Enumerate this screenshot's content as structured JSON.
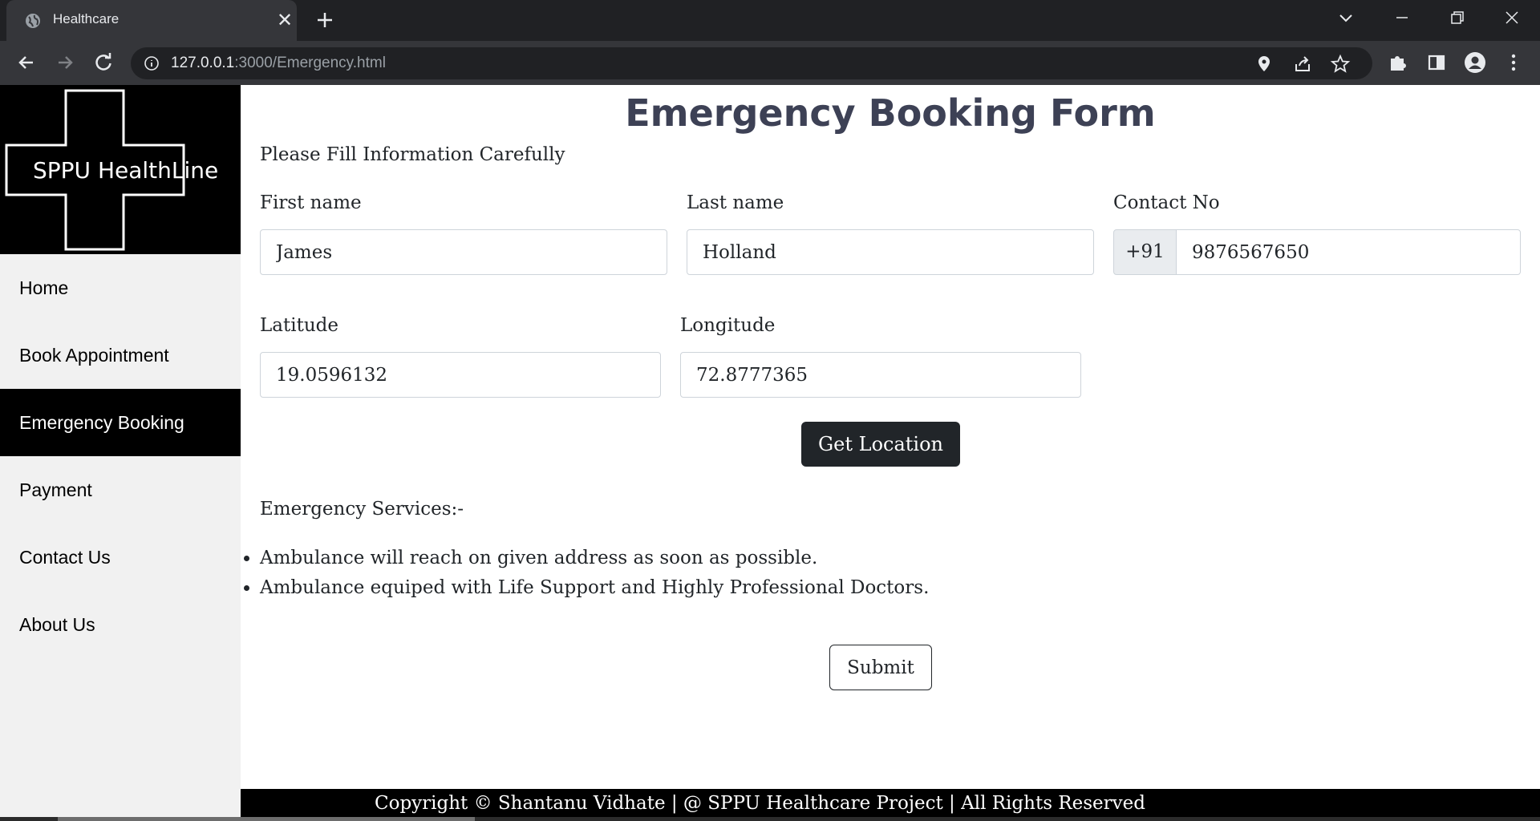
{
  "browser": {
    "tab_title": "Healthcare",
    "url_host": "127.0.0.1",
    "url_rest": ":3000/Emergency.html"
  },
  "sidebar": {
    "logo_text": "SPPU HealthLine",
    "items": [
      {
        "label": "Home"
      },
      {
        "label": "Book Appointment"
      },
      {
        "label": "Emergency Booking",
        "active": true
      },
      {
        "label": "Payment"
      },
      {
        "label": "Contact Us"
      },
      {
        "label": "About Us"
      }
    ]
  },
  "form": {
    "title": "Emergency Booking Form",
    "subtitle": "Please Fill Information Carefully",
    "first_name": {
      "label": "First name",
      "value": "James"
    },
    "last_name": {
      "label": "Last name",
      "value": "Holland"
    },
    "contact": {
      "label": "Contact No",
      "prefix": "+91",
      "value": "9876567650"
    },
    "latitude": {
      "label": "Latitude",
      "value": "19.0596132"
    },
    "longitude": {
      "label": "Longitude",
      "value": "72.8777365"
    },
    "get_location_label": "Get Location",
    "services_title": "Emergency Services:-",
    "services": [
      "Ambulance will reach on given address as soon as possible.",
      "Ambulance equiped with Life Support and Highly Professional Doctors."
    ],
    "submit_label": "Submit"
  },
  "footer": {
    "text": "Copyright © Shantanu Vidhate | @ SPPU Healthcare Project | All Rights Reserved"
  },
  "colors": {
    "title": "#3d4155",
    "dark_button": "#212529",
    "sidebar_bg": "#f1f1f1",
    "active_nav": "#000000"
  }
}
